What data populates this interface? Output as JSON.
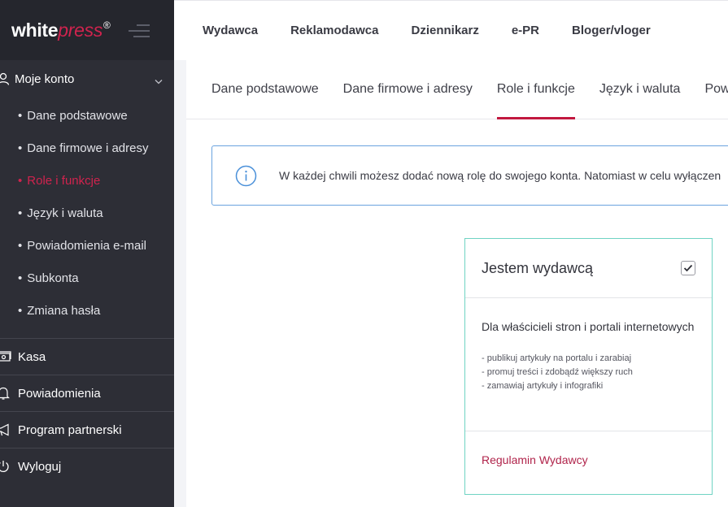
{
  "logo": {
    "white": "white",
    "press": "press",
    "reg": "®"
  },
  "sidebar": {
    "account": {
      "label": "Moje konto"
    },
    "submenu": [
      {
        "label": "Dane podstawowe",
        "active": false
      },
      {
        "label": "Dane firmowe i adresy",
        "active": false
      },
      {
        "label": "Role i funkcje",
        "active": true
      },
      {
        "label": "Język i waluta",
        "active": false
      },
      {
        "label": "Powiadomienia e-mail",
        "active": false
      },
      {
        "label": "Subkonta",
        "active": false
      },
      {
        "label": "Zmiana hasła",
        "active": false
      }
    ],
    "kasa": "Kasa",
    "notifications": "Powiadomienia",
    "partner": "Program partnerski",
    "logout": "Wyloguj"
  },
  "topnav": {
    "items": [
      "Wydawca",
      "Reklamodawca",
      "Dziennikarz",
      "e-PR",
      "Bloger/vloger"
    ]
  },
  "tabs": {
    "items": [
      "Dane podstawowe",
      "Dane firmowe i adresy",
      "Role i funkcje",
      "Język i waluta",
      "Powi"
    ],
    "active_index": 2
  },
  "info": {
    "text": "W każdej chwili możesz dodać nową rolę do swojego konta. Natomiast w celu wyłączen"
  },
  "role_card": {
    "title": "Jestem wydawcą",
    "checked": true,
    "description": "Dla właścicieli stron i portali internetowych",
    "bullets": [
      "- publikuj artykuły na portalu i zarabiaj",
      "- promuj treści i zdobądź większy ruch",
      "- zamawiaj artykuły i infografiki"
    ],
    "link": "Regulamin Wydawcy"
  },
  "colors": {
    "accent": "#c2183f",
    "sidebar_bg": "#2d2e36",
    "info_border": "#6aa3df",
    "card_border": "#6fd3c3"
  }
}
